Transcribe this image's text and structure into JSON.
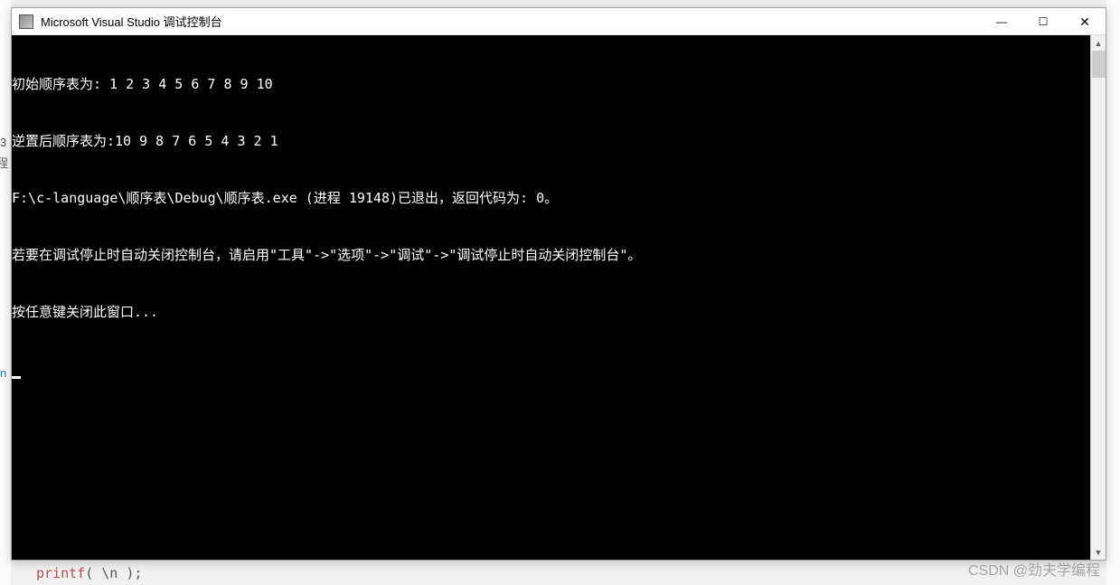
{
  "window": {
    "title": "Microsoft Visual Studio 调试控制台"
  },
  "console": {
    "lines": [
      "初始顺序表为: 1 2 3 4 5 6 7 8 9 10",
      "逆置后顺序表为:10 9 8 7 6 5 4 3 2 1",
      "F:\\c-language\\顺序表\\Debug\\顺序表.exe (进程 19148)已退出，返回代码为: 0。",
      "若要在调试停止时自动关闭控制台，请启用\"工具\"->\"选项\"->\"调试\"->\"调试停止时自动关闭控制台\"。",
      "按任意键关闭此窗口..."
    ]
  },
  "leftStrip": {
    "ch1": "3",
    "ch2": "程",
    "ch3": "n"
  },
  "bottomFragment": {
    "keyword": "printf",
    "rest": "( \\n );"
  },
  "watermark": "CSDN @劲夫学编程",
  "scrollbar": {
    "up": "▲",
    "down": "▼"
  },
  "winControls": {
    "minimize": "—",
    "maximize": "☐",
    "close": "✕"
  }
}
